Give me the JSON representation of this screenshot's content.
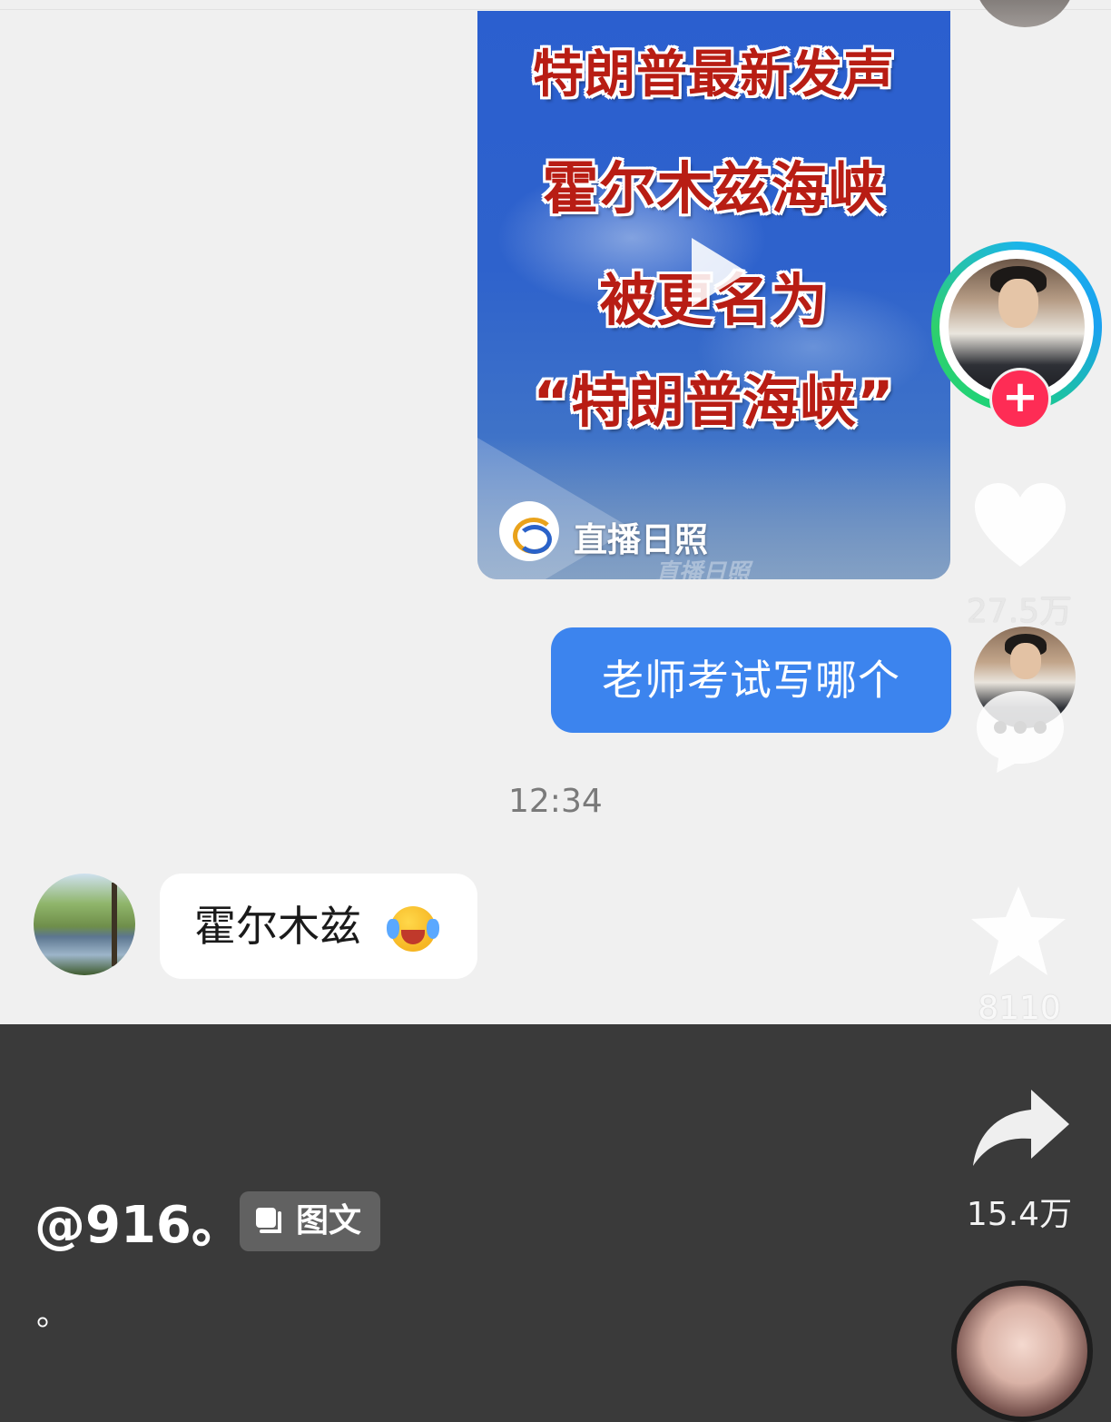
{
  "video_card": {
    "headline_1": "特朗普最新发声",
    "headline_2": "霍尔木兹海峡",
    "headline_3": "被更名为",
    "headline_4": "“特朗普海峡”",
    "channel_name": "直播日照",
    "watermark": "直播日照"
  },
  "my_message": "老师考试写哪个",
  "timestamp": "12:34",
  "reply_message": "霍尔木兹",
  "reply_emoji": "crying-laughing-emoji",
  "actions": {
    "like_count": "27.5万",
    "comment_count": "",
    "favorite_count": "8110",
    "share_count": "15.4万",
    "follow_symbol": "+"
  },
  "post": {
    "author": "@916。",
    "type_tag": "图文",
    "caption": "。"
  },
  "colors": {
    "bubble_blue": "#3c84ee",
    "follow_red": "#fe2c55",
    "headline_red": "#b81d14"
  }
}
